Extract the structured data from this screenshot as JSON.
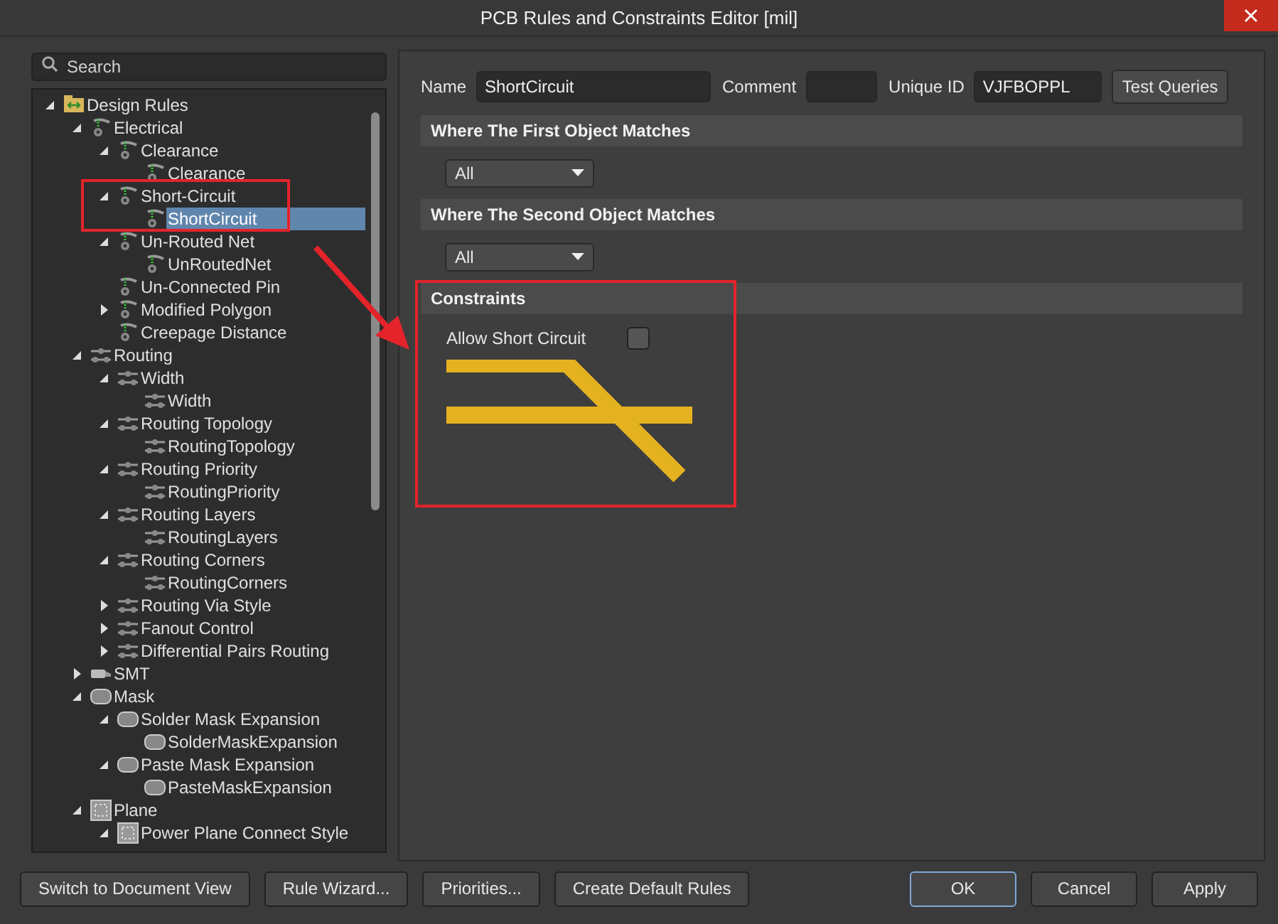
{
  "window": {
    "title": "PCB Rules and Constraints Editor [mil]"
  },
  "search": {
    "placeholder": "Search"
  },
  "tree": [
    {
      "label": "Design Rules",
      "kind": "folder",
      "expanded": true,
      "selected": false,
      "children": [
        {
          "label": "Electrical",
          "kind": "rule",
          "expanded": true,
          "selected": false,
          "children": [
            {
              "label": "Clearance",
              "kind": "rule",
              "expanded": true,
              "selected": false,
              "children": [
                {
                  "label": "Clearance",
                  "kind": "rule",
                  "selected": false
                }
              ]
            },
            {
              "label": "Short-Circuit",
              "kind": "rule",
              "expanded": true,
              "selected": false,
              "children": [
                {
                  "label": "ShortCircuit",
                  "kind": "rule",
                  "selected": true
                }
              ]
            },
            {
              "label": "Un-Routed Net",
              "kind": "rule",
              "expanded": true,
              "selected": false,
              "children": [
                {
                  "label": "UnRoutedNet",
                  "kind": "rule",
                  "selected": false
                }
              ]
            },
            {
              "label": "Un-Connected Pin",
              "kind": "rule",
              "selected": false
            },
            {
              "label": "Modified Polygon",
              "kind": "rule",
              "expanded": false,
              "selected": false
            },
            {
              "label": "Creepage Distance",
              "kind": "rule",
              "selected": false
            }
          ]
        },
        {
          "label": "Routing",
          "kind": "routing",
          "expanded": true,
          "selected": false,
          "children": [
            {
              "label": "Width",
              "kind": "routing",
              "expanded": true,
              "selected": false,
              "children": [
                {
                  "label": "Width",
                  "kind": "routing",
                  "selected": false
                }
              ]
            },
            {
              "label": "Routing Topology",
              "kind": "routing",
              "expanded": true,
              "selected": false,
              "children": [
                {
                  "label": "RoutingTopology",
                  "kind": "routing",
                  "selected": false
                }
              ]
            },
            {
              "label": "Routing Priority",
              "kind": "routing",
              "expanded": true,
              "selected": false,
              "children": [
                {
                  "label": "RoutingPriority",
                  "kind": "routing",
                  "selected": false
                }
              ]
            },
            {
              "label": "Routing Layers",
              "kind": "routing",
              "expanded": true,
              "selected": false,
              "children": [
                {
                  "label": "RoutingLayers",
                  "kind": "routing",
                  "selected": false
                }
              ]
            },
            {
              "label": "Routing Corners",
              "kind": "routing",
              "expanded": true,
              "selected": false,
              "children": [
                {
                  "label": "RoutingCorners",
                  "kind": "routing",
                  "selected": false
                }
              ]
            },
            {
              "label": "Routing Via Style",
              "kind": "routing",
              "expanded": false,
              "selected": false
            },
            {
              "label": "Fanout Control",
              "kind": "routing",
              "expanded": false,
              "selected": false
            },
            {
              "label": "Differential Pairs Routing",
              "kind": "routing",
              "expanded": false,
              "selected": false
            }
          ]
        },
        {
          "label": "SMT",
          "kind": "smt",
          "expanded": false,
          "selected": false
        },
        {
          "label": "Mask",
          "kind": "mask",
          "expanded": true,
          "selected": false,
          "children": [
            {
              "label": "Solder Mask Expansion",
              "kind": "mask",
              "expanded": true,
              "selected": false,
              "children": [
                {
                  "label": "SolderMaskExpansion",
                  "kind": "mask",
                  "selected": false
                }
              ]
            },
            {
              "label": "Paste Mask Expansion",
              "kind": "mask",
              "expanded": true,
              "selected": false,
              "children": [
                {
                  "label": "PasteMaskExpansion",
                  "kind": "mask",
                  "selected": false
                }
              ]
            }
          ]
        },
        {
          "label": "Plane",
          "kind": "plane",
          "expanded": true,
          "selected": false,
          "children": [
            {
              "label": "Power Plane Connect Style",
              "kind": "plane",
              "expanded": true,
              "selected": false
            }
          ]
        }
      ]
    }
  ],
  "rule": {
    "name_label": "Name",
    "name": "ShortCircuit",
    "comment_label": "Comment",
    "unique_id_label": "Unique ID",
    "unique_id": "VJFBOPPL",
    "test_button": "Test Queries"
  },
  "sections": [
    {
      "kind": "scope",
      "title": "Where The First Object Matches",
      "dropdown": "All"
    },
    {
      "kind": "scope",
      "title": "Where The Second Object Matches",
      "dropdown": "All"
    },
    {
      "kind": "constraints",
      "title": "Constraints",
      "checkbox": {
        "label": "Allow Short Circuit",
        "checked": false
      }
    }
  ],
  "buttons": [
    {
      "label": "Switch to Document View",
      "kind": "left"
    },
    {
      "label": "Rule Wizard...",
      "kind": "left"
    },
    {
      "label": "Priorities...",
      "kind": "left"
    },
    {
      "label": "Create Default Rules",
      "kind": "left"
    },
    {
      "label": "OK",
      "kind": "default"
    },
    {
      "label": "Cancel",
      "kind": "right"
    },
    {
      "label": "Apply",
      "kind": "right"
    }
  ]
}
